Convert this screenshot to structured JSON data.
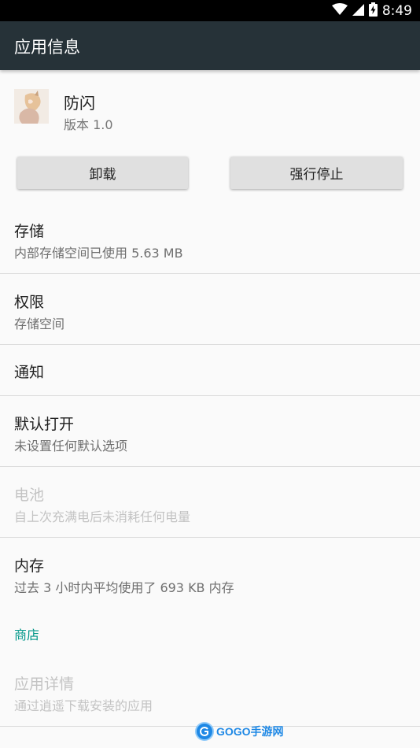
{
  "status_bar": {
    "time": "8:49",
    "icons": [
      "wifi-icon",
      "signal-icon",
      "battery-charging-icon"
    ]
  },
  "toolbar": {
    "title": "应用信息"
  },
  "app": {
    "name": "防闪",
    "version": "版本 1.0"
  },
  "buttons": {
    "uninstall": "卸载",
    "force_stop": "强行停止"
  },
  "settings": [
    {
      "title": "存储",
      "subtitle": "内部存储空间已使用 5.63 MB",
      "enabled": true
    },
    {
      "title": "权限",
      "subtitle": "存储空间",
      "enabled": true
    },
    {
      "title": "通知",
      "subtitle": "",
      "enabled": true
    },
    {
      "title": "默认打开",
      "subtitle": "未设置任何默认选项",
      "enabled": true
    },
    {
      "title": "电池",
      "subtitle": "自上次充满电后未消耗任何电量",
      "enabled": false
    },
    {
      "title": "内存",
      "subtitle": "过去 3 小时内平均使用了 693 KB 内存",
      "enabled": true
    }
  ],
  "store": {
    "header": "商店",
    "item": {
      "title": "应用详情",
      "subtitle": "通过逍遥下载安装的应用",
      "enabled": false
    }
  },
  "watermark": {
    "text": "GOGO手游网"
  },
  "colors": {
    "toolbar": "#263238",
    "accent": "#009688",
    "background": "#fafafa",
    "button": "#e0e0e0"
  }
}
